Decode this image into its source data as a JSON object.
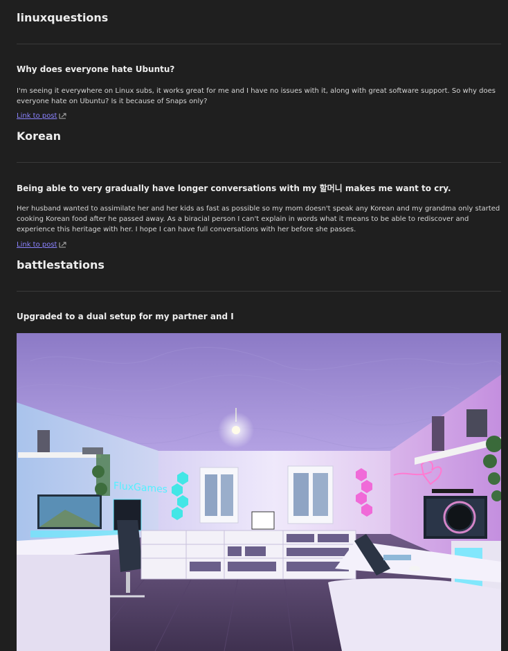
{
  "posts": [
    {
      "subreddit": "linuxquestions",
      "title": "Why does everyone hate Ubuntu?",
      "body": "I'm seeing it everywhere on Linux subs, it works great for me and I have no issues with it, along with great software support. So why does everyone hate on Ubuntu? Is it because of Snaps only?",
      "link_label": "Link to post",
      "link_icon": "external-link-icon"
    },
    {
      "subreddit": "Korean",
      "title": "Being able to very gradually have longer conversations with my 할머니 makes me want to cry.",
      "body": "Her husband wanted to assimilate her and her kids as fast as possible so my mom doesn't speak any Korean and my grandma only started cooking Korean food after he passed away. As a biracial person I can't explain in words what it means to be able to rediscover and experience this heritage with her. I hope I can have full conversations with her before she passes.",
      "link_label": "Link to post",
      "link_icon": "external-link-icon"
    },
    {
      "subreddit": "battlestations",
      "title": "Upgraded to a dual setup for my partner and I",
      "image": {
        "description_icon": "battlestation-photo",
        "neon_sign_left": "FluxGames"
      }
    }
  ],
  "colors": {
    "background": "#1f1f1f",
    "link": "#8b83ff",
    "divider": "#3a3a3a"
  }
}
